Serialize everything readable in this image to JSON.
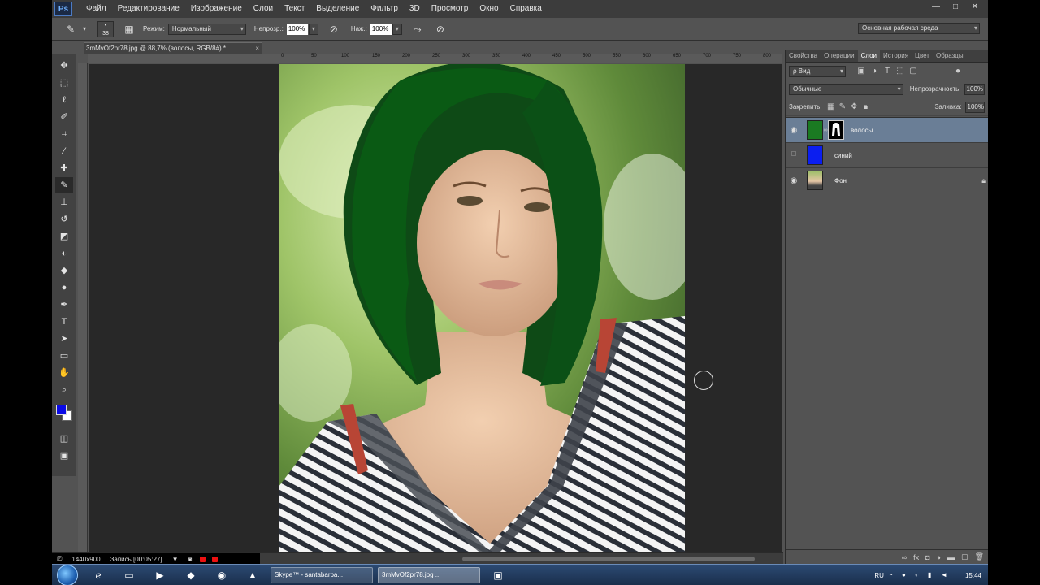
{
  "app": {
    "logo": "Ps",
    "menu": [
      "Файл",
      "Редактирование",
      "Изображение",
      "Слои",
      "Текст",
      "Выделение",
      "Фильтр",
      "3D",
      "Просмотр",
      "Окно",
      "Справка"
    ],
    "window_controls": [
      "—",
      "□",
      "✕"
    ]
  },
  "options": {
    "brush_size": "38",
    "mode_label": "Режим:",
    "mode_value": "Нормальный",
    "opacity_label": "Непрозр.:",
    "opacity_value": "100%",
    "flow_label": "Наж.:",
    "flow_value": "100%",
    "workspace": "Основная рабочая среда"
  },
  "document": {
    "tab_title": "3mMvOf2pr78.jpg @ 88,7% (волосы, RGB/8#) *",
    "tab_close": "×",
    "ruler_ticks": [
      "0",
      "50",
      "100",
      "150",
      "200",
      "250",
      "300",
      "350",
      "400",
      "450",
      "500",
      "550",
      "600",
      "650",
      "700",
      "750",
      "800"
    ]
  },
  "status": {
    "doc_size": "1440x900",
    "recording": "Запись [00:05:27]"
  },
  "tools": [
    "move-tool",
    "marquee-tool",
    "lasso-tool",
    "quick-select-tool",
    "crop-tool",
    "eyedropper-tool",
    "healing-tool",
    "brush-tool",
    "stamp-tool",
    "history-brush-tool",
    "eraser-tool",
    "gradient-tool",
    "blur-tool",
    "dodge-tool",
    "pen-tool",
    "type-tool",
    "path-select-tool",
    "shape-tool",
    "hand-tool",
    "zoom-tool"
  ],
  "colors": {
    "foreground": "#0a0ae6",
    "background": "#ffffff",
    "layer_selected": "#6a7e96",
    "blue_fill": "#0b1ef0"
  },
  "panel": {
    "tabs": [
      "Свойства",
      "Операции",
      "Слои",
      "История",
      "Цвет",
      "Образцы"
    ],
    "active_tab": "Слои",
    "filter_value": "ρ Вид",
    "blend_mode": "Обычные",
    "opacity_label": "Непрозрачность:",
    "opacity_value": "100%",
    "lock_label": "Закрепить:",
    "fill_label": "Заливка:",
    "fill_value": "100%",
    "layers": [
      {
        "name": "волосы",
        "visible": true,
        "selected": true,
        "has_mask": true
      },
      {
        "name": "синий",
        "visible": false,
        "selected": false,
        "has_mask": false
      },
      {
        "name": "Фон",
        "visible": true,
        "selected": false,
        "locked": true
      }
    ]
  },
  "taskbar": {
    "tasks": [
      {
        "label": "Skype™ - santabarba...",
        "active": false
      },
      {
        "label": "3mMvOf2pr78.jpg ...",
        "active": true
      }
    ],
    "lang": "RU",
    "time": "15:44"
  }
}
